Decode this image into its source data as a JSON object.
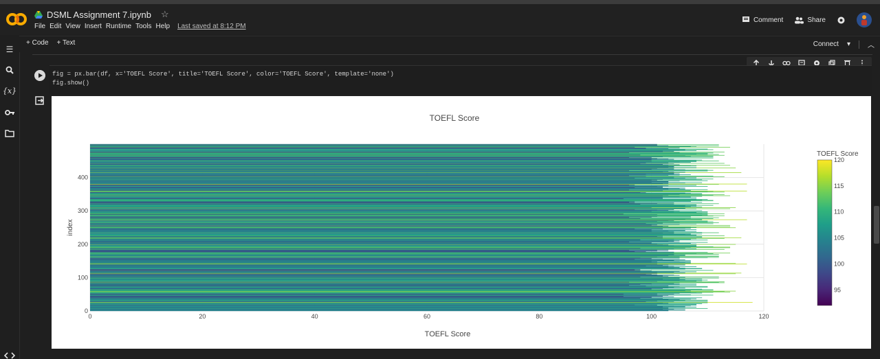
{
  "app": {
    "notebook_title": "DSML Assignment 7.ipynb",
    "menu": [
      "File",
      "Edit",
      "View",
      "Insert",
      "Runtime",
      "Tools",
      "Help"
    ],
    "last_saved": "Last saved at 8:12 PM",
    "comment_label": "Comment",
    "share_label": "Share",
    "add_code_label": "+ Code",
    "add_text_label": "+ Text",
    "connect_label": "Connect"
  },
  "cell": {
    "code_line1": "fig = px.bar(df, x='TOEFL Score', title='TOEFL Score', color='TOEFL Score', template='none')",
    "code_line2": "fig.show()"
  },
  "colors": {
    "viridis": [
      "#440154",
      "#482878",
      "#3e4989",
      "#31688e",
      "#26828e",
      "#1f9e89",
      "#35b779",
      "#6ece58",
      "#b5de2b",
      "#fde725"
    ]
  },
  "chart_data": {
    "type": "bar",
    "orientation": "horizontal",
    "title": "TOEFL Score",
    "xlabel": "TOEFL Score",
    "ylabel": "index",
    "xlim": [
      0,
      120
    ],
    "ylim": [
      0,
      500
    ],
    "xticks": [
      0,
      20,
      40,
      60,
      80,
      100,
      120
    ],
    "yticks": [
      0,
      100,
      200,
      300,
      400
    ],
    "colorbar": {
      "title": "TOEFL Score",
      "range": [
        92,
        120
      ],
      "ticks": [
        95,
        100,
        105,
        110,
        115,
        120
      ]
    },
    "value_range": [
      92,
      120
    ],
    "n_bars": 500,
    "grid": true,
    "legend": "right colorbar"
  }
}
